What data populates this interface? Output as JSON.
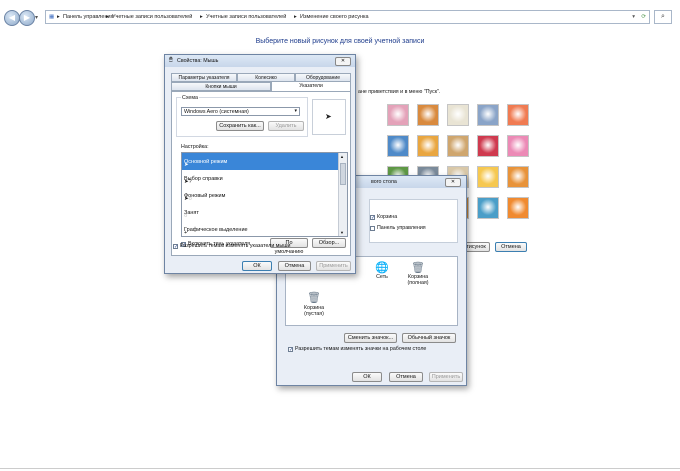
{
  "address_bar": {
    "crumbs": [
      "Панель управления",
      "Учетные записи пользователей",
      "Учетные записи пользователей",
      "Изменение своего рисунка"
    ]
  },
  "page": {
    "title": "Выберите новый рисунок для своей учетной записи",
    "hint": "ане приветствия и в меню \"Пуск\".",
    "buttons": {
      "change": "тисунок",
      "cancel": "Отмена"
    }
  },
  "picture_tiles": {
    "colors": [
      "#e4a2b9",
      "#d98a3e",
      "#e9e4d4",
      "#8aa4c8",
      "#f07b52",
      "#4f8ac8",
      "#e9a640",
      "#cfa66e",
      "#cf3a4f",
      "#ec8ab6",
      "#5e9845",
      "#7a8a9a",
      "#d9c8a8",
      "#f6c850",
      "#e8933a",
      "#2e74c8",
      "#d8d4cc",
      "#cc8a3a",
      "#4a9ec8",
      "#f08a30"
    ]
  },
  "desktop_icons_window": {
    "title": "вого стола",
    "checkboxes": [
      {
        "label": "Корзина",
        "checked": true
      },
      {
        "label": "Панель управления",
        "checked": false
      }
    ],
    "icons": [
      {
        "label": "Сеть"
      },
      {
        "label": "Корзина (полная)"
      },
      {
        "label": "Корзина (пустая)"
      }
    ],
    "change_icon_button": "Сменить значок...",
    "default_icon_button": "Обычный значок",
    "allow_themes": "Разрешить темам изменять значки на рабочем столе",
    "ok": "ОК",
    "cancel": "Отмена",
    "apply": "Применить"
  },
  "mouse_window": {
    "title": "Свойства: Мышь",
    "tabs_row1": [
      "Параметры указателя",
      "Колесико",
      "Оборудование"
    ],
    "tabs_row2": [
      "Кнопки мыши",
      "Указатели"
    ],
    "scheme_group": "Схема",
    "scheme_value": "Windows Aero (системная)",
    "save_as": "Сохранить как...",
    "delete": "Удалить",
    "settings_label": "Настройка:",
    "pointers": [
      {
        "name": "Основной режим",
        "glyph": "➤",
        "selected": true
      },
      {
        "name": "Выбор справки",
        "glyph": "➤?",
        "selected": false
      },
      {
        "name": "Фоновый режим",
        "glyph": "➤◌",
        "selected": false
      },
      {
        "name": "Занят",
        "glyph": "◌",
        "selected": false
      },
      {
        "name": "Графическое выделение",
        "glyph": "+",
        "selected": false
      }
    ],
    "enable_shadow": "Включить тень указателя",
    "default_button": "По умолчанию",
    "browse_button": "Обзор...",
    "allow_themes": "Разрешить темам изменять указатели мыши",
    "ok": "ОК",
    "cancel": "Отмена",
    "apply": "Применить"
  }
}
